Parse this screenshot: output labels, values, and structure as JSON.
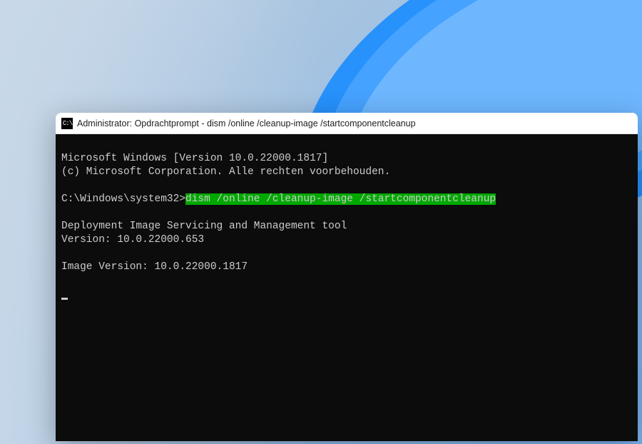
{
  "window": {
    "title": "Administrator: Opdrachtprompt - dism  /online /cleanup-image /startcomponentcleanup",
    "icon_label": "C:\\"
  },
  "terminal": {
    "line1": "Microsoft Windows [Version 10.0.22000.1817]",
    "line2": "(c) Microsoft Corporation. Alle rechten voorbehouden.",
    "blank1": "",
    "prompt_prefix": "C:\\Windows\\system32>",
    "command": "dism /online /cleanup-image /startcomponentcleanup",
    "blank2": "",
    "tool_line": "Deployment Image Servicing and Management tool",
    "version_line": "Version: 10.0.22000.653",
    "blank3": "",
    "image_version_line": "Image Version: 10.0.22000.1817",
    "blank4": ""
  }
}
